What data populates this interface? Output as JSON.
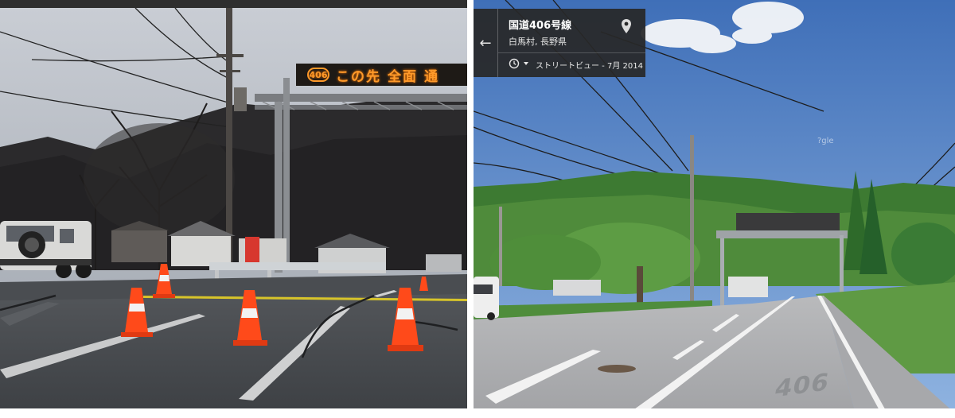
{
  "left_photo": {
    "led_sign": {
      "route_number": "406",
      "text_1": "この先",
      "text_2": "全面",
      "text_3": "通"
    }
  },
  "street_view": {
    "title": "国道406号線",
    "location": "白馬村, 長野県",
    "capture_label": "ストリートビュー - 7月 2014",
    "watermark": "?gle",
    "road_marking": "406"
  },
  "colors": {
    "card_bg": "#282828",
    "led_orange": "#ff9a2a",
    "cone_orange": "#ff4a1a"
  }
}
